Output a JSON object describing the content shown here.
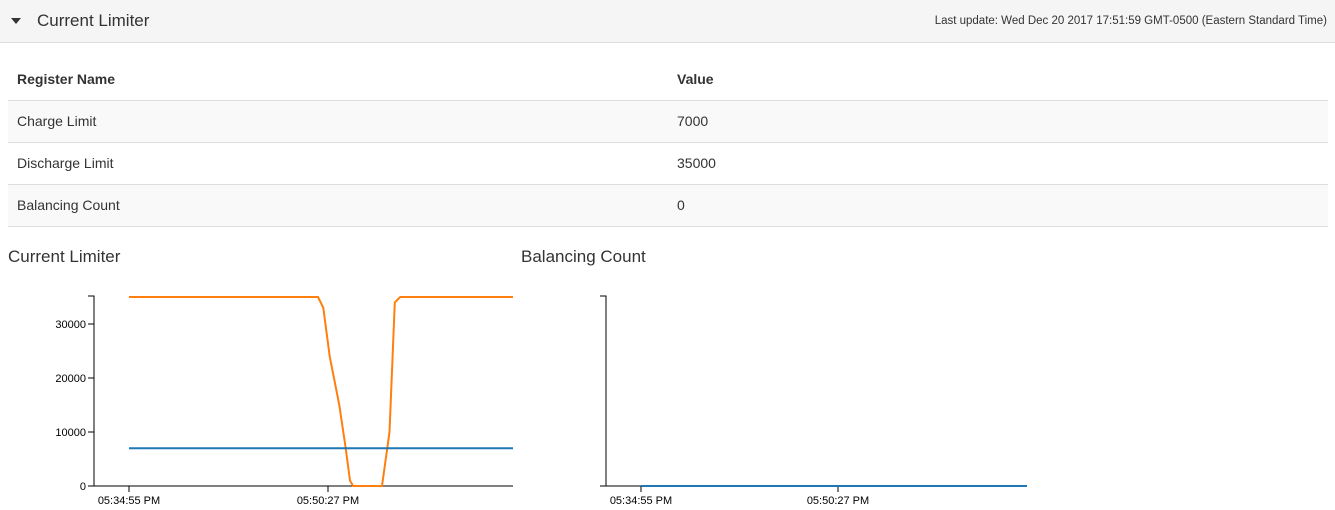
{
  "panel": {
    "title": "Current Limiter",
    "last_update": "Last update: Wed Dec 20 2017 17:51:59 GMT-0500 (Eastern Standard Time)"
  },
  "table": {
    "headers": [
      "Register Name",
      "Value"
    ],
    "rows": [
      {
        "name": "Charge Limit",
        "value": "7000"
      },
      {
        "name": "Discharge Limit",
        "value": "35000"
      },
      {
        "name": "Balancing Count",
        "value": "0"
      }
    ]
  },
  "charts": {
    "current_limiter_title": "Current Limiter",
    "balancing_count_title": "Balancing Count"
  },
  "colors": {
    "charge_line": "#1f77b4",
    "discharge_line": "#ff7f0e",
    "balancing_line": "#1f77b4"
  },
  "chart_data": [
    {
      "type": "line",
      "title": "Current Limiter",
      "xlabel": "",
      "ylabel": "",
      "x_ticks": [
        "05:34:55 PM",
        "05:50:27 PM"
      ],
      "y_ticks": [
        0,
        10000,
        20000,
        30000
      ],
      "xlim": [
        "05:34:55 PM",
        "05:51:59 PM"
      ],
      "ylim": [
        0,
        35000
      ],
      "grid": false,
      "series": [
        {
          "color": "#ff7f0e",
          "points": [
            [
              "05:34:55 PM",
              35000
            ],
            [
              "05:49:40 PM",
              35000
            ],
            [
              "05:50:05 PM",
              33000
            ],
            [
              "05:50:35 PM",
              24000
            ],
            [
              "05:51:20 PM",
              15000
            ],
            [
              "05:51:50 PM",
              7000
            ],
            [
              "05:52:10 PM",
              1000
            ],
            [
              "05:52:25 PM",
              0
            ],
            [
              "05:54:40 PM",
              0
            ],
            [
              "05:55:15 PM",
              10000
            ],
            [
              "05:55:40 PM",
              34000
            ],
            [
              "05:56:05 PM",
              35000
            ],
            [
              "05:59:55 PM",
              35000
            ]
          ]
        },
        {
          "color": "#1f77b4",
          "points": [
            [
              "05:34:55 PM",
              7000
            ],
            [
              "05:59:55 PM",
              7000
            ]
          ]
        }
      ]
    },
    {
      "type": "line",
      "title": "Balancing Count",
      "xlabel": "",
      "ylabel": "",
      "x_ticks": [
        "05:34:55 PM",
        "05:50:27 PM"
      ],
      "y_ticks": [],
      "grid": false,
      "series": [
        {
          "color": "#1f77b4",
          "points": [
            [
              "05:34:55 PM",
              0
            ],
            [
              "05:59:55 PM",
              0
            ]
          ]
        }
      ]
    }
  ]
}
